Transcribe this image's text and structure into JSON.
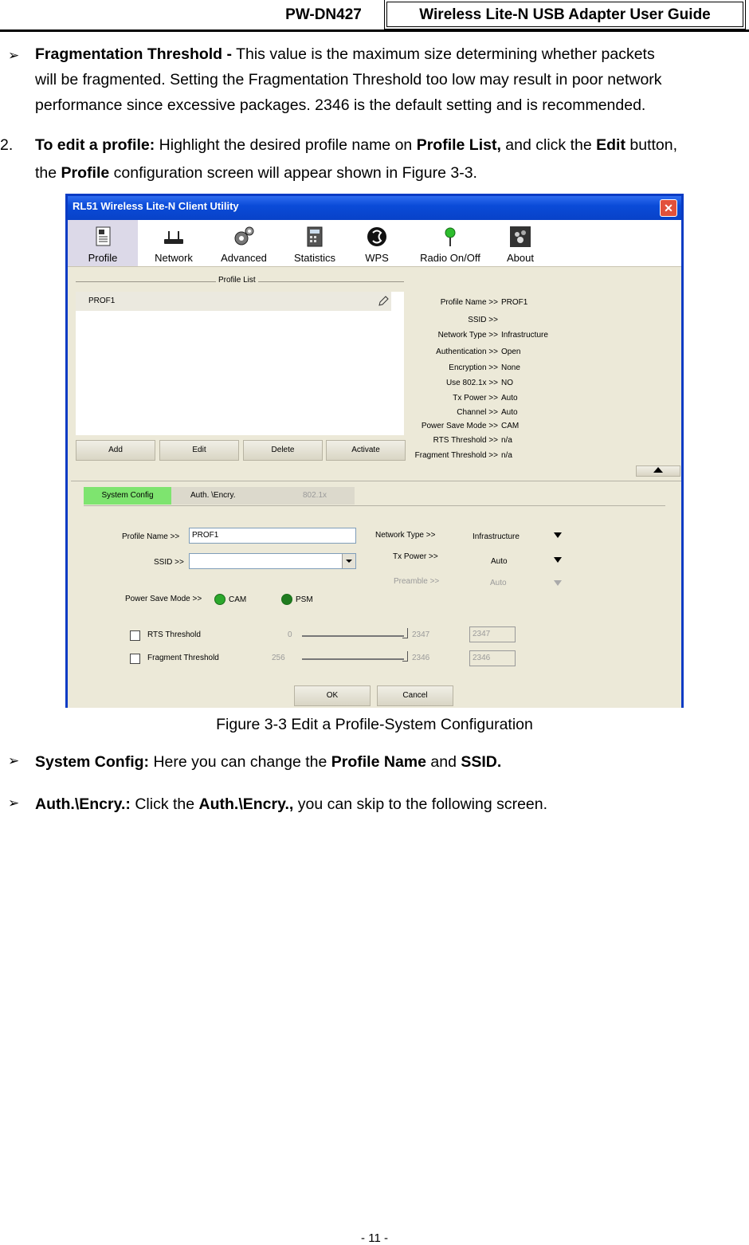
{
  "header": {
    "model": "PW-DN427",
    "title": "Wireless Lite-N USB Adapter User Guide"
  },
  "frag": {
    "term": "Fragmentation Threshold -",
    "line1": "This value is the maximum size determining whether packets",
    "line2": "will be fragmented. Setting the Fragmentation Threshold too low may result in poor network",
    "line3": "performance since excessive packages. 2346 is the default setting and is recommended."
  },
  "step2": {
    "number": "2.",
    "term": "To edit a profile:",
    "t1": "Highlight the desired profile name on",
    "b1": "Profile List,",
    "t2": "and click the",
    "b2": "Edit",
    "t3": "button,",
    "t4": "the",
    "b3": "Profile",
    "t5": "configuration screen will appear shown in Figure 3-3."
  },
  "window": {
    "title": "RL51 Wireless Lite-N Client Utility",
    "close": "✕",
    "toolbar": [
      "Profile",
      "Network",
      "Advanced",
      "Statistics",
      "WPS",
      "Radio On/Off",
      "About"
    ],
    "profile_list_label": "Profile List",
    "profile_row": "PROF1",
    "buttons": {
      "add": "Add",
      "edit": "Edit",
      "delete": "Delete",
      "activate": "Activate"
    },
    "info": [
      {
        "k": "Profile Name >>",
        "v": "PROF1"
      },
      {
        "k": "SSID >>",
        "v": ""
      },
      {
        "k": "Network Type >>",
        "v": "Infrastructure"
      },
      {
        "k": "Authentication >>",
        "v": "Open"
      },
      {
        "k": "Encryption >>",
        "v": "None"
      },
      {
        "k": "Use 802.1x >>",
        "v": "NO"
      },
      {
        "k": "Tx Power >>",
        "v": "Auto"
      },
      {
        "k": "Channel >>",
        "v": "Auto"
      },
      {
        "k": "Power Save Mode >>",
        "v": "CAM"
      },
      {
        "k": "RTS Threshold >>",
        "v": "n/a"
      },
      {
        "k": "Fragment Threshold >>",
        "v": "n/a"
      }
    ],
    "tabs": {
      "system": "System Config",
      "auth": "Auth. \\Encry.",
      "x": "802.1x"
    },
    "form": {
      "profile_name_label": "Profile Name >>",
      "profile_name_value": "PROF1",
      "ssid_label": "SSID >>",
      "ssid_value": "",
      "network_type_label": "Network Type >>",
      "network_type_value": "Infrastructure",
      "tx_power_label": "Tx Power >>",
      "tx_power_value": "Auto",
      "preamble_label": "Preamble >>",
      "preamble_value": "Auto",
      "power_save_label": "Power Save Mode >>",
      "cam": "CAM",
      "psm": "PSM",
      "rts_label": "RTS Threshold",
      "rts_min": "0",
      "rts_max": "2347",
      "rts_value": "2347",
      "frag_label": "Fragment Threshold",
      "frag_min": "256",
      "frag_max": "2346",
      "frag_value": "2346",
      "ok": "OK",
      "cancel": "Cancel"
    }
  },
  "caption": "Figure 3-3 Edit a Profile-System Configuration",
  "bullets": {
    "sys_term": "System Config:",
    "sys_t1": "Here you can change the",
    "sys_b1": "Profile Name",
    "sys_t2": "and",
    "sys_b2": "SSID.",
    "auth_term": "Auth.\\Encry.:",
    "auth_t1": "Click the",
    "auth_b1": "Auth.\\Encry.,",
    "auth_t2": "you can skip to the following screen."
  },
  "page_number": "- 11 -"
}
